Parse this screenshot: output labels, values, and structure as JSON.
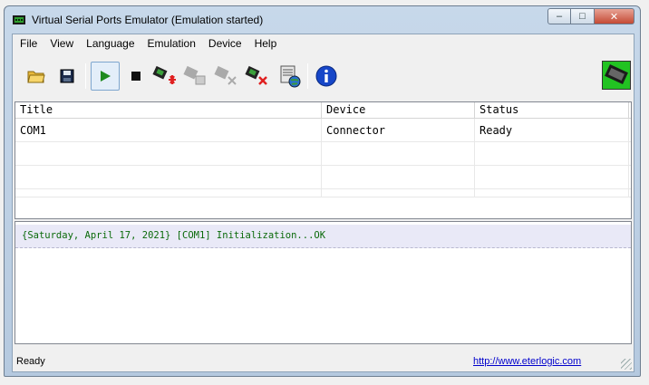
{
  "window": {
    "title": "Virtual Serial Ports Emulator (Emulation started)",
    "app_icon": "serial-port-icon"
  },
  "caption_buttons": {
    "minimize": "–",
    "maximize": "□",
    "close": "✕"
  },
  "menu": [
    "File",
    "View",
    "Language",
    "Emulation",
    "Device",
    "Help"
  ],
  "toolbar": {
    "buttons": [
      {
        "name": "open-icon"
      },
      {
        "name": "save-icon"
      },
      {
        "name": "start-emulation-icon",
        "pressed": true
      },
      {
        "name": "stop-emulation-icon"
      },
      {
        "name": "create-device-icon"
      },
      {
        "name": "device-properties-icon",
        "disabled": true
      },
      {
        "name": "delete-device-icon",
        "disabled": true
      },
      {
        "name": "delete-all-devices-icon"
      },
      {
        "name": "device-network-icon"
      },
      {
        "name": "info-icon"
      }
    ],
    "right_icon": "com-port-icon"
  },
  "grid": {
    "columns": [
      "Title",
      "Device",
      "Status"
    ],
    "rows": [
      [
        "COM1",
        "Connector",
        "Ready"
      ]
    ]
  },
  "log": {
    "lines": [
      "{Saturday, April 17, 2021} [COM1] Initialization...OK"
    ]
  },
  "status": {
    "text": "Ready",
    "link": "http://www.eterlogic.com"
  },
  "colors": {
    "log_text": "#0a6a0a",
    "link": "#0000cc",
    "window_frame": "#c7d8ea"
  }
}
